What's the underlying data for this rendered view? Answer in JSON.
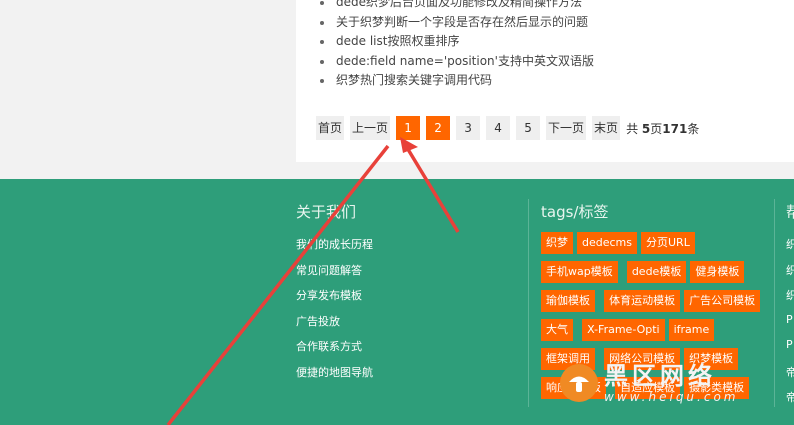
{
  "related_articles": [
    "dede织梦后台页面及功能修改及精简操作方法",
    "关于织梦判断一个字段是否存在然后显示的问题",
    "dede list按照权重排序",
    "dede:field name='position'支持中英文双语版",
    "织梦热门搜索关键字调用代码"
  ],
  "pagination": {
    "first": "首页",
    "prev": "上一页",
    "pages": [
      "1",
      "2",
      "3",
      "4",
      "5"
    ],
    "current": "1",
    "next": "下一页",
    "last": "末页",
    "total_prefix": "共",
    "total_pages": "5",
    "total_mid": "页",
    "total_records": "171",
    "total_suffix": "条"
  },
  "footer": {
    "about": {
      "title": "关于我们",
      "links": [
        "我们的成长历程",
        "常见问题解答",
        "分享发布模板",
        "广告投放",
        "合作联系方式",
        "便捷的地图导航"
      ]
    },
    "tags": {
      "title": "tags/标签",
      "items": [
        "织梦",
        "dedecms",
        "分页URL",
        "手机wap模板",
        "dede模板",
        "健身模板",
        "瑜伽模板",
        "体育运动模板",
        "广告公司模板",
        "大气",
        "X-Frame-Opti",
        "iframe",
        "框架调用",
        "网络公司模板",
        "织梦模板",
        "响应式模板",
        "自适应模板",
        "摄影类模板"
      ]
    },
    "third": {
      "title": "帮",
      "links": [
        "织",
        "织",
        "织",
        "P",
        "P",
        "帝",
        "帝"
      ]
    }
  },
  "watermark": {
    "title": "黑区网络",
    "url": "www.heiqu.com"
  },
  "colors": {
    "accent": "#ff6600",
    "footer_bg": "#2e9e7a",
    "arrow": "#e8413a"
  }
}
